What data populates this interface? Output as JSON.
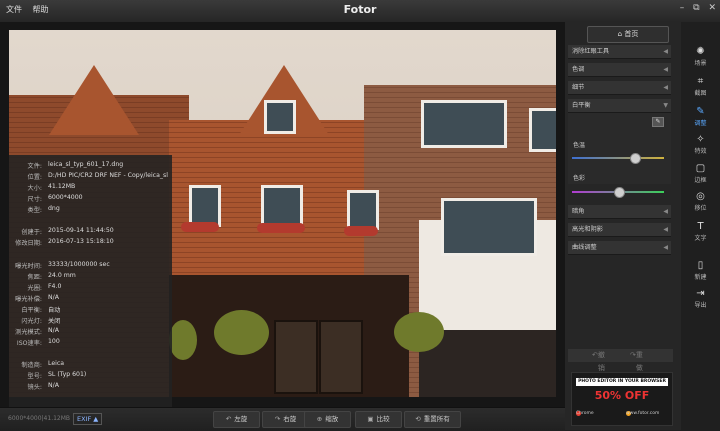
{
  "app": {
    "title": "Fotor",
    "menu": [
      "文件",
      "帮助"
    ]
  },
  "window_controls": {
    "minimize": "–",
    "restore": "⧉",
    "close": "✕"
  },
  "photo_info": {
    "rows": [
      {
        "k": "文件:",
        "v": "leica_sl_typ_601_17.dng"
      },
      {
        "k": "位置:",
        "v": "D:/HD PIC/CR2 DRF NEF - Copy/leica_sl"
      },
      {
        "k": "大小:",
        "v": "41.12MB"
      },
      {
        "k": "尺寸:",
        "v": "6000*4000"
      },
      {
        "k": "类型:",
        "v": "dng"
      },
      {
        "k": "创建于:",
        "v": "2015-09-14 11:44:50"
      },
      {
        "k": "修改日期:",
        "v": "2016-07-13 15:18:10"
      },
      {
        "k": "曝光时间:",
        "v": "33333/1000000 sec"
      },
      {
        "k": "焦距:",
        "v": "24.0 mm"
      },
      {
        "k": "光圈:",
        "v": "F4.0"
      },
      {
        "k": "曝光补偿:",
        "v": "N/A"
      },
      {
        "k": "白平衡:",
        "v": "自动"
      },
      {
        "k": "闪光灯:",
        "v": "关闭"
      },
      {
        "k": "测光模式:",
        "v": "N/A"
      },
      {
        "k": "ISO速率:",
        "v": "100"
      },
      {
        "k": "制造商:",
        "v": "Leica"
      },
      {
        "k": "型号:",
        "v": "SL (Typ 601)"
      },
      {
        "k": "镜头:",
        "v": "N/A"
      }
    ]
  },
  "bottombar": {
    "meta": "6000*4000|41.12MB",
    "exif_label": "EXIF ▲",
    "buttons": [
      {
        "label": "左旋",
        "icon": "↶"
      },
      {
        "label": "右旋",
        "icon": "↷"
      },
      {
        "label": "缩放",
        "icon": "⊕"
      },
      {
        "label": "比较",
        "icon": "▣"
      },
      {
        "label": "重置所有",
        "icon": "⟲"
      }
    ]
  },
  "right_panel": {
    "home_label": "首页",
    "sections": [
      "消除红眼工具",
      "色调",
      "细节",
      "白平衡"
    ],
    "wb_labels": {
      "temp": "色温",
      "tint": "色彩"
    },
    "wb_values": {
      "temp": 0.7,
      "tint": 0.5
    },
    "lower_sections": [
      "暗角",
      "高光和阴影",
      "曲线调整"
    ],
    "undo": "撤销",
    "redo": "重做",
    "ad": {
      "headline": "PHOTO EDITOR IN YOUR BROWSER",
      "sale": "50% OFF",
      "chrome": "Chrome",
      "site": "www.fotor.com"
    }
  },
  "tools": [
    {
      "label": "场景",
      "icon": "✺",
      "name": "scene-icon"
    },
    {
      "label": "截图",
      "icon": "⌗",
      "name": "crop-icon"
    },
    {
      "label": "调整",
      "icon": "✎",
      "name": "adjust-icon",
      "active": true
    },
    {
      "label": "特效",
      "icon": "✧",
      "name": "effects-icon"
    },
    {
      "label": "边框",
      "icon": "▢",
      "name": "frame-icon"
    },
    {
      "label": "移位",
      "icon": "◎",
      "name": "tilt-shift-icon"
    },
    {
      "label": "文字",
      "icon": "T",
      "name": "text-icon"
    },
    {
      "label": "新建",
      "icon": "▯",
      "name": "new-icon"
    },
    {
      "label": "导出",
      "icon": "⇥",
      "name": "export-icon"
    }
  ],
  "colors": {
    "accent": "#5aa9ff",
    "sale": "#e33333"
  }
}
